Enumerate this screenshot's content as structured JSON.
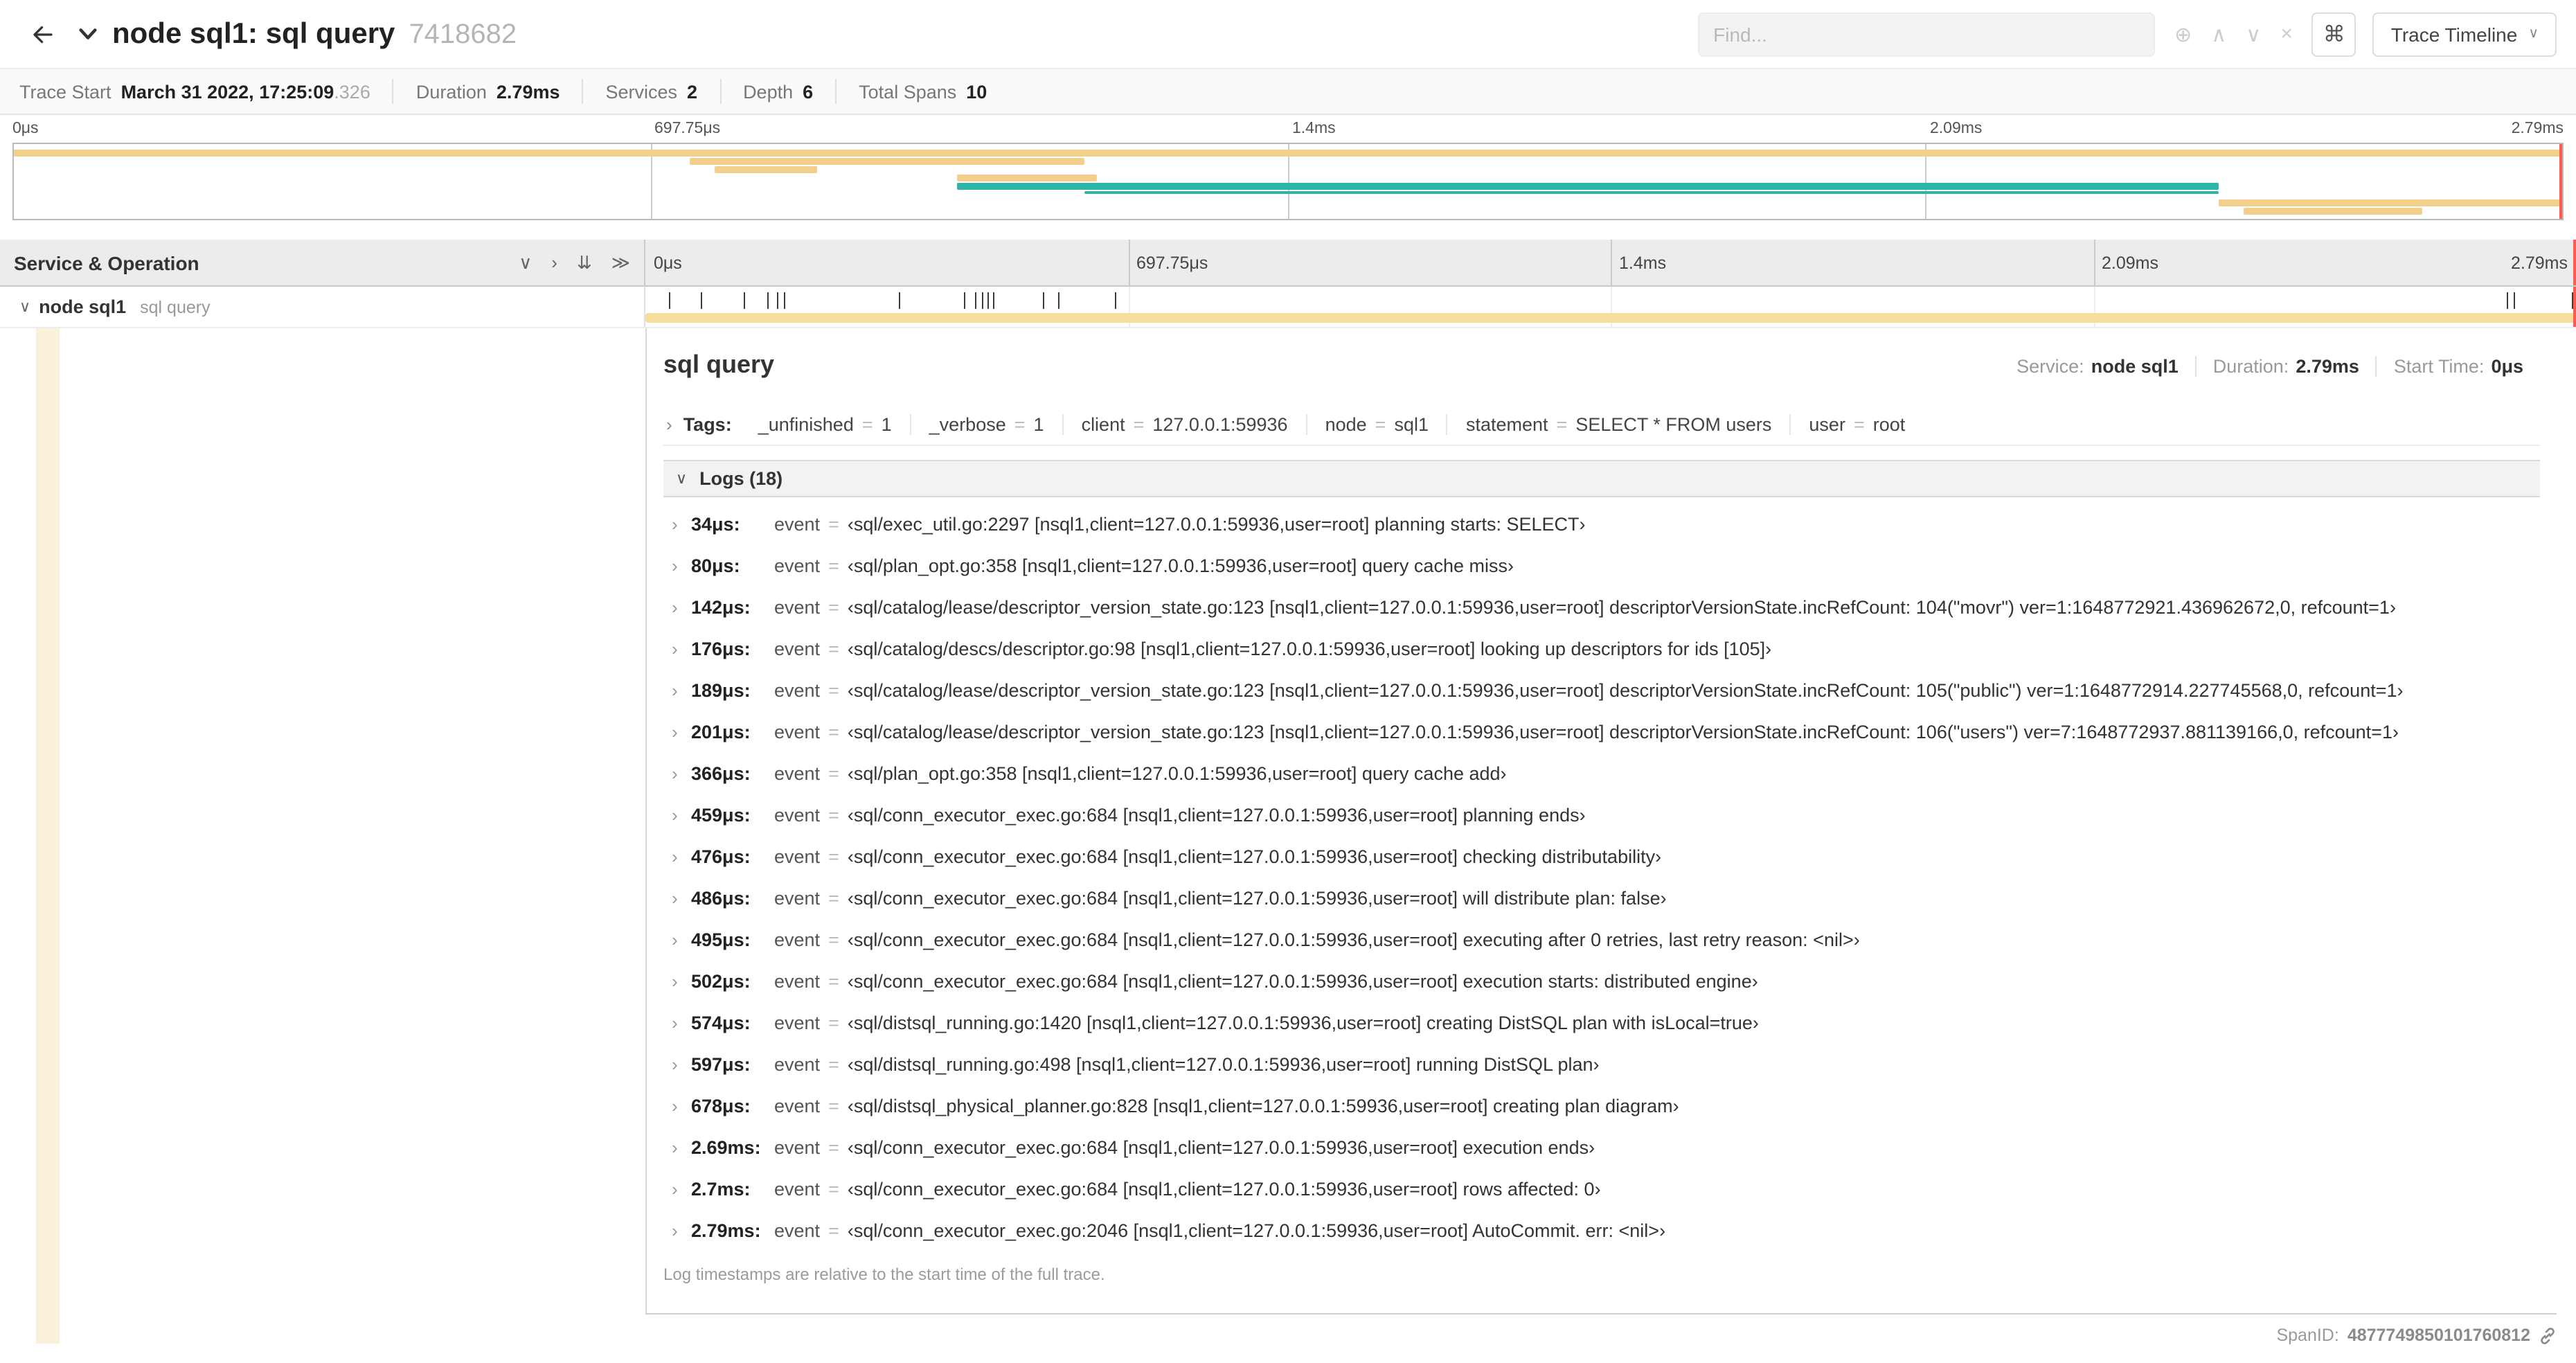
{
  "topbar": {
    "title": "node sql1: sql query",
    "trace_id": "7418682",
    "find_placeholder": "Find...",
    "focus_icon": "⊕",
    "prev_icon": "∧",
    "next_icon": "∨",
    "clear_icon": "×",
    "shortcut_icon": "⌘",
    "view_select": "Trace Timeline",
    "view_caret": "∨"
  },
  "infobar": {
    "items": [
      {
        "label": "Trace Start",
        "value": "March 31 2022, 17:25:09",
        "suffix": ".326"
      },
      {
        "label": "Duration",
        "value": "2.79ms"
      },
      {
        "label": "Services",
        "value": "2"
      },
      {
        "label": "Depth",
        "value": "6"
      },
      {
        "label": "Total Spans",
        "value": "10"
      }
    ]
  },
  "timeline": {
    "header_left": "Service & Operation",
    "ticks": [
      "0μs",
      "697.75μs",
      "1.4ms",
      "2.09ms",
      "2.79ms"
    ],
    "controls": [
      {
        "name": "collapse-one-icon",
        "glyph": "∨"
      },
      {
        "name": "expand-one-icon",
        "glyph": "›"
      },
      {
        "name": "collapse-all-icon",
        "glyph": "⇊"
      },
      {
        "name": "expand-all-icon",
        "glyph": "≫"
      }
    ]
  },
  "minimap": {
    "bars": [
      {
        "r": 0,
        "l": 0,
        "w": 100,
        "c": "tan"
      },
      {
        "r": 1,
        "l": 26.5,
        "w": 15.5,
        "c": "tan"
      },
      {
        "r": 2,
        "l": 27.5,
        "w": 4,
        "c": "tan"
      },
      {
        "r": 3,
        "l": 37,
        "w": 5.5,
        "c": "tan"
      },
      {
        "r": 4,
        "l": 37,
        "w": 49.5,
        "c": "teal"
      },
      {
        "r": 5,
        "l": 42,
        "w": 44.5,
        "c": "teal",
        "h": 2
      },
      {
        "r": 6,
        "l": 86.5,
        "w": 13.5,
        "c": "tan"
      },
      {
        "r": 7,
        "l": 87.5,
        "w": 7,
        "c": "tan"
      }
    ]
  },
  "span_row": {
    "expander": "∨",
    "service": "node sql1",
    "operation": "sql query",
    "log_tick_pcts": [
      1.2,
      2.9,
      5.1,
      6.3,
      6.8,
      7.2,
      13.1,
      16.5,
      17.1,
      17.4,
      17.7,
      18.0,
      20.6,
      21.4,
      24.3,
      96.4,
      96.8,
      99.8
    ]
  },
  "detail": {
    "title": "sql query",
    "service_label": "Service:",
    "service_value": "node sql1",
    "duration_label": "Duration:",
    "duration_value": "2.79ms",
    "start_label": "Start Time:",
    "start_value": "0μs",
    "tags_label": "Tags:",
    "tags": [
      {
        "key": "_unfinished",
        "value": "1"
      },
      {
        "key": "_verbose",
        "value": "1"
      },
      {
        "key": "client",
        "value": "127.0.0.1:59936"
      },
      {
        "key": "node",
        "value": "sql1"
      },
      {
        "key": "statement",
        "value": "SELECT * FROM users"
      },
      {
        "key": "user",
        "value": "root"
      }
    ],
    "logs_label": "Logs (18)",
    "logs": [
      {
        "time": "34μs:",
        "key": "event",
        "value": "‹sql/exec_util.go:2297 [nsql1,client=127.0.0.1:59936,user=root] planning starts: SELECT›"
      },
      {
        "time": "80μs:",
        "key": "event",
        "value": "‹sql/plan_opt.go:358 [nsql1,client=127.0.0.1:59936,user=root] query cache miss›"
      },
      {
        "time": "142μs:",
        "key": "event",
        "value": "‹sql/catalog/lease/descriptor_version_state.go:123 [nsql1,client=127.0.0.1:59936,user=root] descriptorVersionState.incRefCount: 104(\"movr\") ver=1:1648772921.436962672,0, refcount=1›"
      },
      {
        "time": "176μs:",
        "key": "event",
        "value": "‹sql/catalog/descs/descriptor.go:98 [nsql1,client=127.0.0.1:59936,user=root] looking up descriptors for ids [105]›"
      },
      {
        "time": "189μs:",
        "key": "event",
        "value": "‹sql/catalog/lease/descriptor_version_state.go:123 [nsql1,client=127.0.0.1:59936,user=root] descriptorVersionState.incRefCount: 105(\"public\") ver=1:1648772914.227745568,0, refcount=1›"
      },
      {
        "time": "201μs:",
        "key": "event",
        "value": "‹sql/catalog/lease/descriptor_version_state.go:123 [nsql1,client=127.0.0.1:59936,user=root] descriptorVersionState.incRefCount: 106(\"users\") ver=7:1648772937.881139166,0, refcount=1›"
      },
      {
        "time": "366μs:",
        "key": "event",
        "value": "‹sql/plan_opt.go:358 [nsql1,client=127.0.0.1:59936,user=root] query cache add›"
      },
      {
        "time": "459μs:",
        "key": "event",
        "value": "‹sql/conn_executor_exec.go:684 [nsql1,client=127.0.0.1:59936,user=root] planning ends›"
      },
      {
        "time": "476μs:",
        "key": "event",
        "value": "‹sql/conn_executor_exec.go:684 [nsql1,client=127.0.0.1:59936,user=root] checking distributability›"
      },
      {
        "time": "486μs:",
        "key": "event",
        "value": "‹sql/conn_executor_exec.go:684 [nsql1,client=127.0.0.1:59936,user=root] will distribute plan: false›"
      },
      {
        "time": "495μs:",
        "key": "event",
        "value": "‹sql/conn_executor_exec.go:684 [nsql1,client=127.0.0.1:59936,user=root] executing after 0 retries, last retry reason: <nil>›"
      },
      {
        "time": "502μs:",
        "key": "event",
        "value": "‹sql/conn_executor_exec.go:684 [nsql1,client=127.0.0.1:59936,user=root] execution starts: distributed engine›"
      },
      {
        "time": "574μs:",
        "key": "event",
        "value": "‹sql/distsql_running.go:1420 [nsql1,client=127.0.0.1:59936,user=root] creating DistSQL plan with isLocal=true›"
      },
      {
        "time": "597μs:",
        "key": "event",
        "value": "‹sql/distsql_running.go:498 [nsql1,client=127.0.0.1:59936,user=root] running DistSQL plan›"
      },
      {
        "time": "678μs:",
        "key": "event",
        "value": "‹sql/distsql_physical_planner.go:828 [nsql1,client=127.0.0.1:59936,user=root] creating plan diagram›"
      },
      {
        "time": "2.69ms:",
        "key": "event",
        "value": "‹sql/conn_executor_exec.go:684 [nsql1,client=127.0.0.1:59936,user=root] execution ends›"
      },
      {
        "time": "2.7ms:",
        "key": "event",
        "value": "‹sql/conn_executor_exec.go:684 [nsql1,client=127.0.0.1:59936,user=root] rows affected: 0›"
      },
      {
        "time": "2.79ms:",
        "key": "event",
        "value": "‹sql/conn_executor_exec.go:2046 [nsql1,client=127.0.0.1:59936,user=root] AutoCommit. err: <nil>›"
      }
    ],
    "footer_note": "Log timestamps are relative to the start time of the full trace.",
    "span_id_label": "SpanID:",
    "span_id": "4877749850101760812"
  },
  "colors": {
    "tan": "#F2CF8A",
    "tan_light": "#F7DCA0",
    "teal": "#2FB5A8",
    "strip": "#FAF1DA",
    "cursor": "#FF5A52"
  }
}
